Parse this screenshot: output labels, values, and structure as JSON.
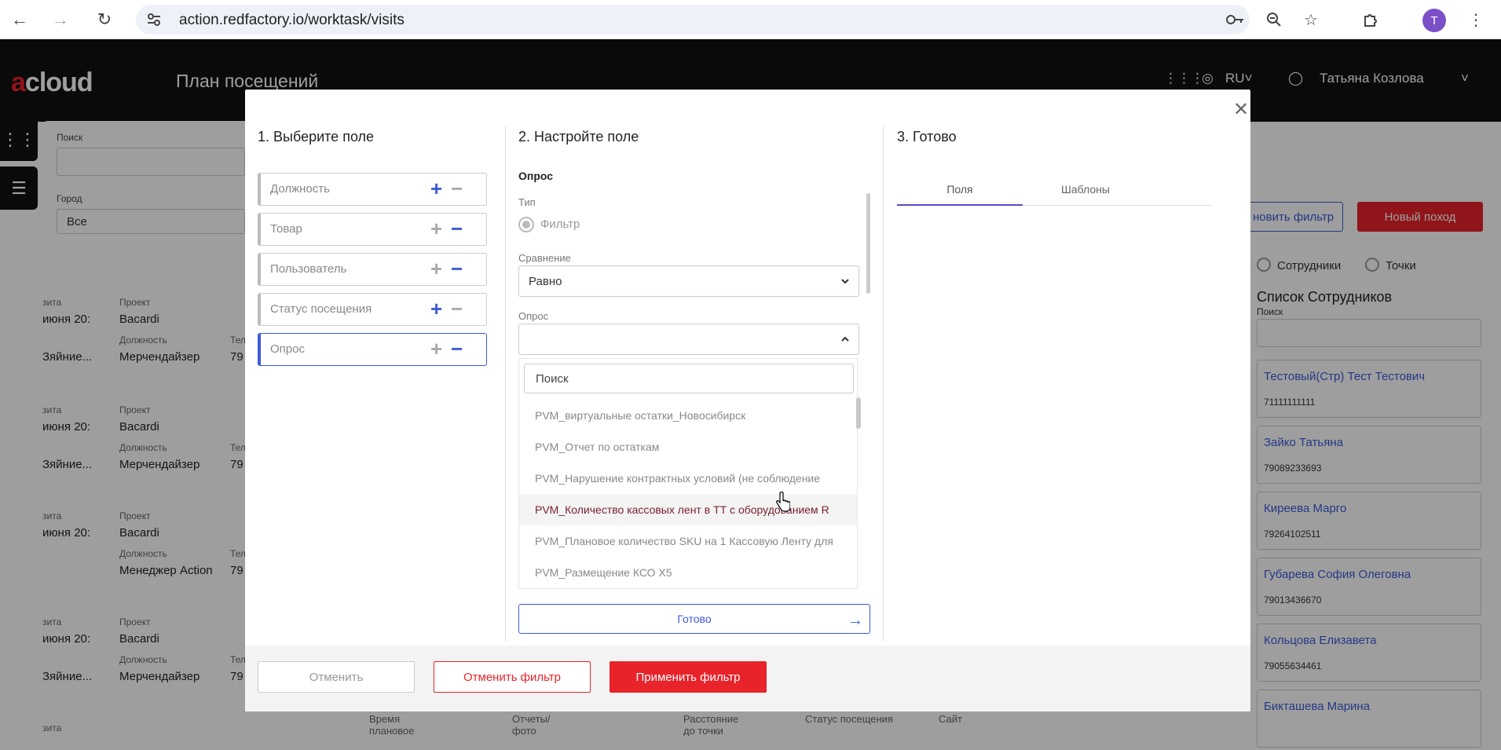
{
  "browser": {
    "url": "action.redfactory.io/worktask/visits",
    "avatar_letter": "T"
  },
  "header": {
    "logo_a": "a",
    "logo_rest": "cl​oud",
    "title": "План посещений",
    "language": "RU",
    "user_name": "Татьяна Козлова"
  },
  "filters": {
    "search_label": "Поиск",
    "city_label": "Город",
    "city_value": "Все"
  },
  "actions": {
    "update_filter": "новить фильтр",
    "new_visit": "Новый поход"
  },
  "visit_cards": [
    {
      "date_label": "зита",
      "date": "июня 20:",
      "project_label": "Проект",
      "project": "Bacardi",
      "role_label": "Должность",
      "role": "Мерчендайзер",
      "addr": "Зяйние...",
      "tel_label": "Тел",
      "tel": "79"
    },
    {
      "date_label": "зита",
      "date": "июня 20:",
      "project_label": "Проект",
      "project": "Bacardi",
      "role_label": "Должность",
      "role": "Мерчендайзер",
      "addr": "Зяйние...",
      "tel_label": "Тел",
      "tel": "79"
    },
    {
      "date_label": "зита",
      "date": "июня 20:",
      "project_label": "Проект",
      "project": "Bacardi",
      "role_label": "Должность",
      "role": "Менеджер Action",
      "addr": "",
      "tel_label": "Тел",
      "tel": "79"
    },
    {
      "date_label": "зита",
      "date": "июня 20:",
      "project_label": "Проект",
      "project": "Bacardi",
      "role_label": "Должность",
      "role": "Мерчендайзер",
      "addr": "Зяйние...",
      "tel_label": "Тел",
      "tel": "79"
    },
    {
      "date_label": "зита",
      "date": "",
      "project_label": "Проект",
      "project": "",
      "role_label": "",
      "role": "",
      "addr": "",
      "tel_label": "",
      "tel": ""
    }
  ],
  "bottom_row": {
    "time_label": "Время плановое",
    "reports_label": "Отчеты/фото",
    "distance_label": "Расстояние до точки",
    "status_label": "Статус посещения",
    "site_label": "Сайт"
  },
  "right_panel": {
    "radio_employees": "Сотрудники",
    "radio_points": "Точки",
    "title": "Список Сотрудников",
    "search_label": "Поиск",
    "employees": [
      {
        "name": "Тестовый(Стр) Тест Тестович",
        "phone": "71111111111"
      },
      {
        "name": "Зайко Татьяна",
        "phone": "79089233693"
      },
      {
        "name": "Киреева Марго",
        "phone": "79264102511"
      },
      {
        "name": "Губарева София Олеговна",
        "phone": "79013436670"
      },
      {
        "name": "Кольцова Елизавета",
        "phone": "79055634461"
      },
      {
        "name": "Бикташева Марина",
        "phone": ""
      }
    ]
  },
  "modal": {
    "step1_title": "1. Выберите поле",
    "step2_title": "2. Настройте поле",
    "step3_title": "3. Готово",
    "fields": [
      {
        "label": "Должность",
        "plus": "+",
        "minus": "−"
      },
      {
        "label": "Товар",
        "plus": "+",
        "minus": "−"
      },
      {
        "label": "Пользователь",
        "plus": "+",
        "minus": "−"
      },
      {
        "label": "Статус посещения",
        "plus": "+",
        "minus": "−"
      },
      {
        "label": "Опрос",
        "plus": "+",
        "minus": "−"
      }
    ],
    "config": {
      "section": "Опрос",
      "type_label": "Тип",
      "type_value": "Фильтр",
      "compare_label": "Сравнение",
      "compare_value": "Равно",
      "survey_label": "Опрос",
      "survey_value": "",
      "search_placeholder": "Поиск",
      "options": [
        "PVM_виртуальные остатки_Новосибирск",
        "PVM_Отчет по остаткам",
        "PVM_Нарушение контрактных условий (не соблюдение",
        "PVM_Количество кассовых лент в ТТ с оборудованием R",
        "PVM_Плановое количество SKU на 1 Кассовую Ленту для",
        "PVM_Размещение КСО X5"
      ],
      "ready_button": "Готово"
    },
    "tabs": [
      "Поля",
      "Шаблоны"
    ],
    "footer": {
      "cancel": "Отменить",
      "reset": "Отменить фильтр",
      "apply": "Применить фильтр"
    }
  }
}
